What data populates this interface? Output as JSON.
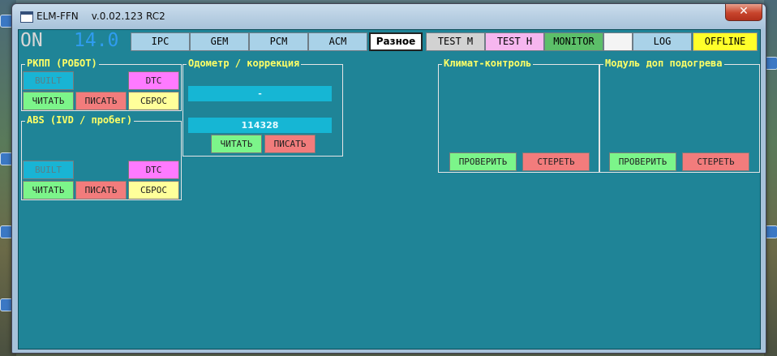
{
  "window": {
    "app_name": "ELM-FFN",
    "version": "v.0.02.123 RC2",
    "close_glyph": "✕"
  },
  "status": {
    "ignition": "ON",
    "voltage": "14.0"
  },
  "tabs": [
    {
      "label": "IPC"
    },
    {
      "label": "GEM"
    },
    {
      "label": "PCM"
    },
    {
      "label": "ACM"
    },
    {
      "label": "Разное"
    },
    {
      "label": "TEST M"
    },
    {
      "label": "TEST H"
    },
    {
      "label": "MONITOR"
    },
    {
      "label": ""
    },
    {
      "label": "LOG"
    },
    {
      "label": "OFFLINE"
    }
  ],
  "rkpp": {
    "title": "РКПП (РОБОТ)",
    "built": "BUILT",
    "dtc": "DTC",
    "read": "ЧИТАТЬ",
    "write": "ПИСАТЬ",
    "reset": "СБРОС"
  },
  "abs": {
    "title": "ABS (IVD / пробег)",
    "built": "BUILT",
    "dtc": "DTC",
    "read": "ЧИТАТЬ",
    "write": "ПИСАТЬ",
    "reset": "СБРОС"
  },
  "odometer": {
    "title": "Одометр / коррекция",
    "value_top": "-",
    "value": "114328",
    "read": "ЧИТАТЬ",
    "write": "ПИСАТЬ"
  },
  "climate": {
    "title": "Климат-контроль",
    "check": "ПРОВЕРИТЬ",
    "erase": "СТЕРЕТЬ"
  },
  "heater": {
    "title": "Модуль доп подогрева",
    "check": "ПРОВЕРИТЬ",
    "erase": "СТЕРЕТЬ"
  },
  "colors": {
    "panel": "#1f8497",
    "label": "#ffff66",
    "voltage": "#2f9cf0"
  }
}
